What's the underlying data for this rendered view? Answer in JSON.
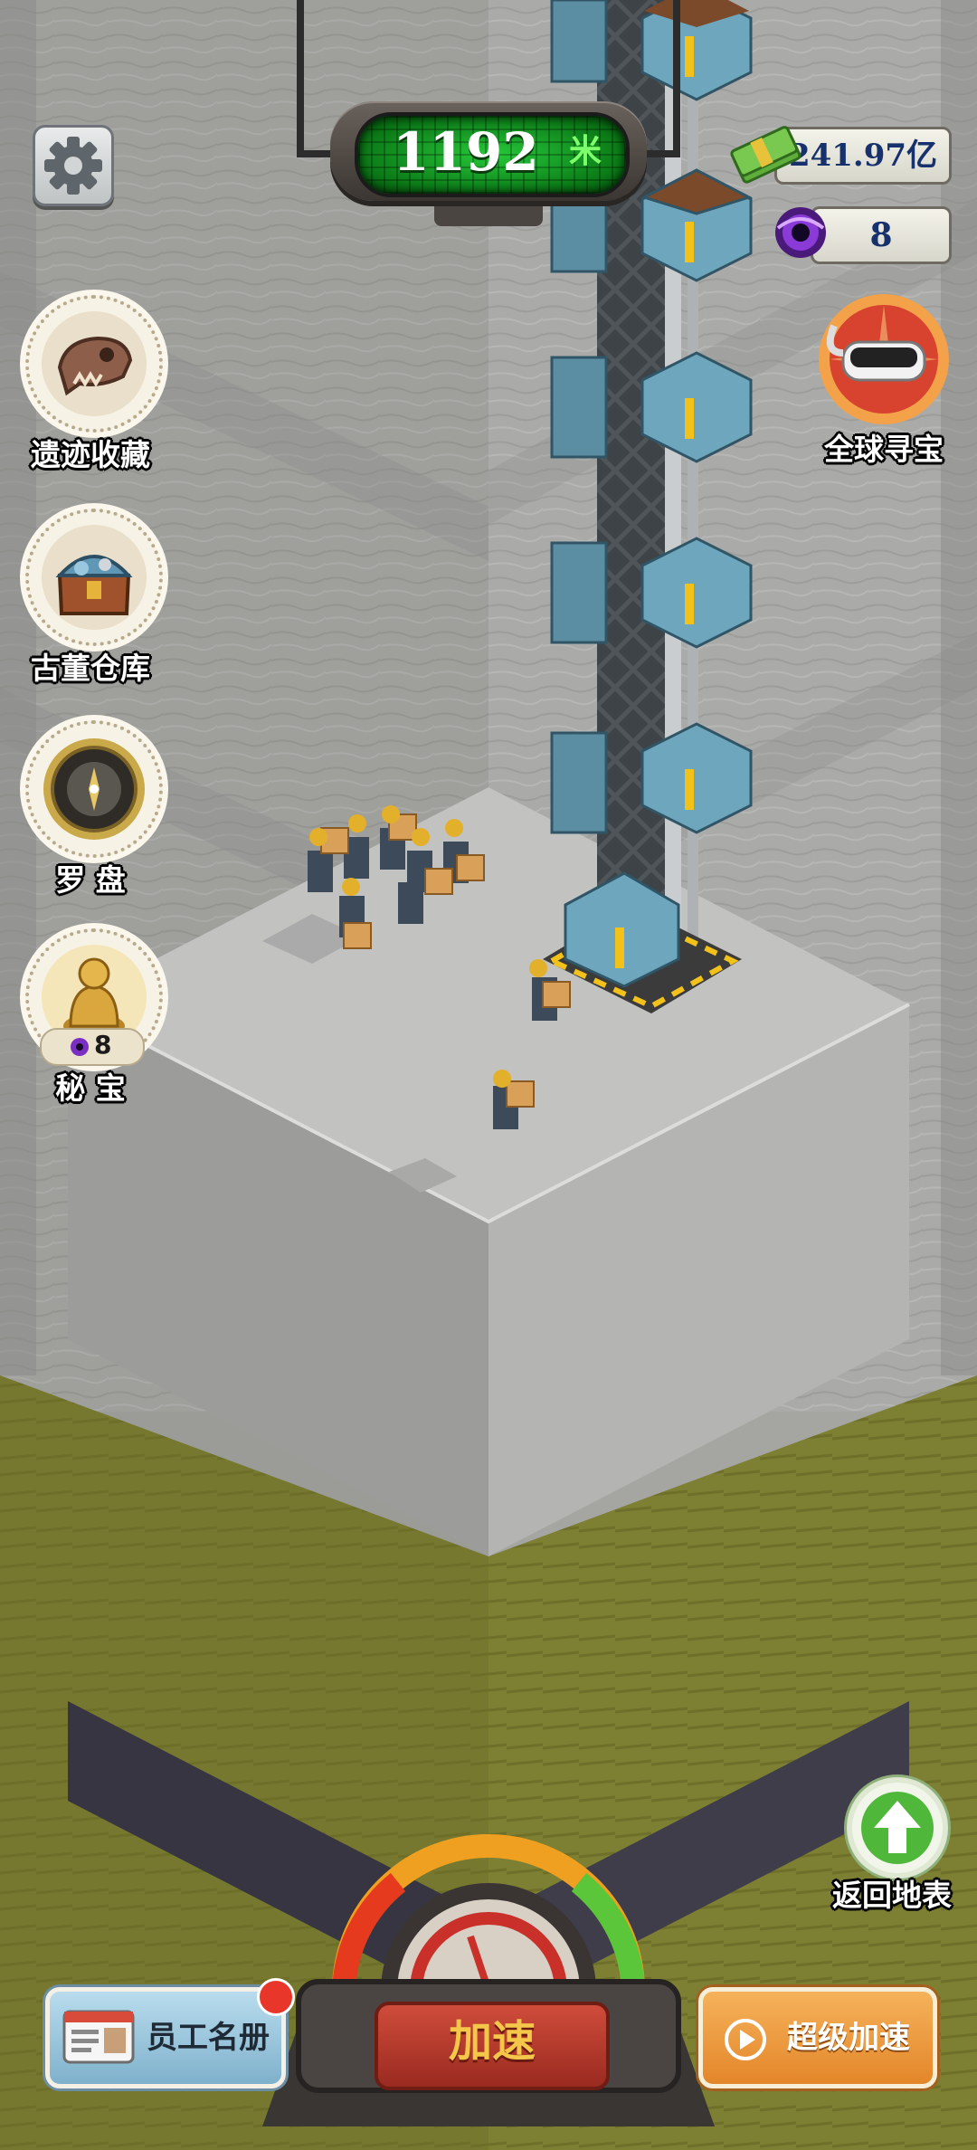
{
  "hud": {
    "depth": "1192",
    "depth_unit": "米",
    "money": "241.97亿",
    "gems": "8"
  },
  "sidebar_left": [
    {
      "label": "遗迹收藏",
      "icon": "dinosaur-skull-icon"
    },
    {
      "label": "古董仓库",
      "icon": "treasure-chest-icon"
    },
    {
      "label": "罗 盘",
      "icon": "compass-icon"
    },
    {
      "label": "秘 宝",
      "icon": "buddha-statue-icon",
      "cost": "8"
    }
  ],
  "global_treasure": {
    "label": "全球寻宝",
    "icon": "vr-headset-icon"
  },
  "return_surface": {
    "label": "返回地表"
  },
  "bottom": {
    "staff_roster": "员工名册",
    "speed_up": "加速",
    "super_speed": "超级加速"
  },
  "colors": {
    "rock": "#a2a2a0",
    "soil": "#7e8030",
    "depth_screen": "#16a428",
    "speed_button": "#b8372a",
    "super_button": "#e8922b",
    "staff_button": "#8fbad3"
  }
}
